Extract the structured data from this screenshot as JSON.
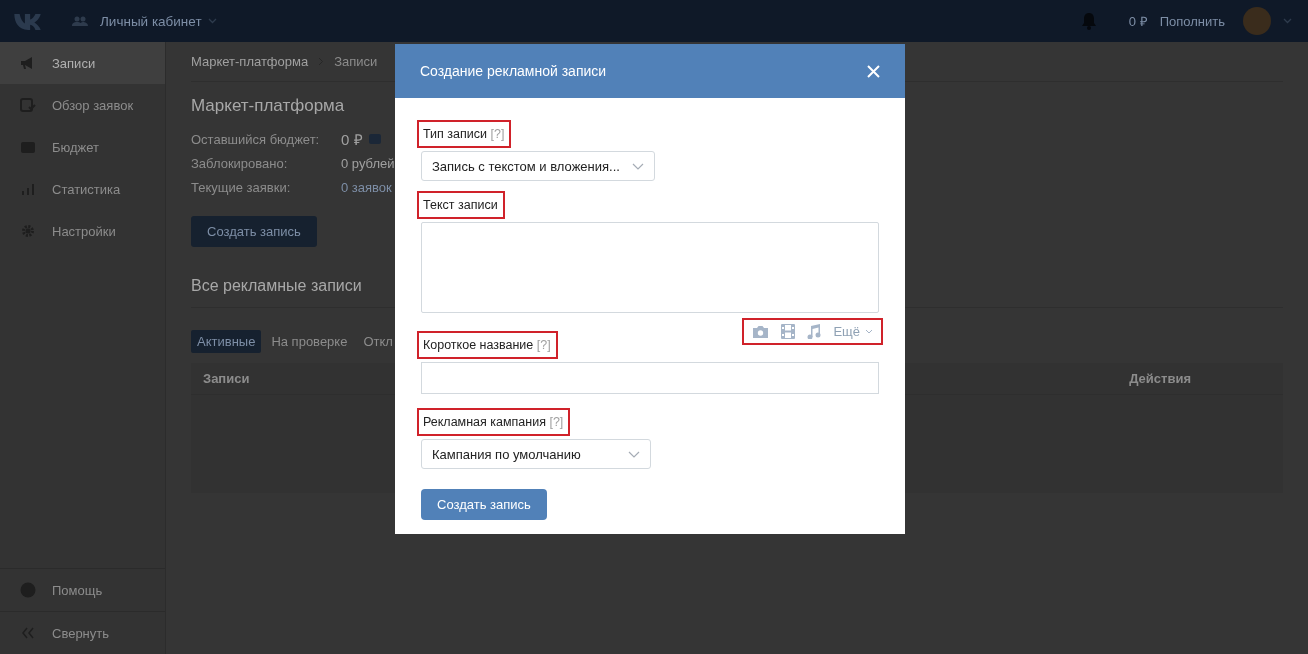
{
  "topbar": {
    "title": "Личный кабинет",
    "balance": "0 ₽",
    "topup": "Пополнить"
  },
  "sidebar": {
    "items": [
      {
        "label": "Записи",
        "selected": true
      },
      {
        "label": "Обзор заявок",
        "selected": false
      },
      {
        "label": "Бюджет",
        "selected": false
      },
      {
        "label": "Статистика",
        "selected": false
      },
      {
        "label": "Настройки",
        "selected": false
      }
    ],
    "footer": [
      {
        "label": "Помощь"
      },
      {
        "label": "Свернуть"
      }
    ]
  },
  "main": {
    "breadcrumbs": [
      "Маркет-платформа",
      "Записи"
    ],
    "title": "Маркет-платформа",
    "stats": [
      {
        "label": "Оставшийся бюджет:",
        "value": "0 ₽",
        "kind": "big"
      },
      {
        "label": "Заблокировано:",
        "value": "0 рублей",
        "kind": "plain"
      },
      {
        "label": "Текущие заявки:",
        "value": "0 заявок",
        "kind": "link"
      }
    ],
    "create_button": "Создать запись",
    "section_title": "Все рекламные записи",
    "tabs": [
      {
        "label": "Активные",
        "selected": true
      },
      {
        "label": "На проверке",
        "selected": false
      },
      {
        "label": "Откл",
        "selected": false
      }
    ],
    "table": {
      "columns": [
        "Записи",
        "Действия"
      ]
    }
  },
  "modal": {
    "title": "Создание рекламной записи",
    "fields": [
      {
        "kind": "select",
        "label": "Тип записи",
        "hint": "[?]",
        "value": "Запись с текстом и вложения...",
        "highlighted": true
      },
      {
        "kind": "textarea",
        "label": "Текст записи",
        "highlighted": true,
        "attachments": {
          "more": "Ещё",
          "highlighted": true
        }
      },
      {
        "kind": "input",
        "label": "Короткое название",
        "hint": "[?]",
        "highlighted": true
      },
      {
        "kind": "select",
        "label": "Рекламная кампания",
        "hint": "[?]",
        "value": "Кампания по умолчанию",
        "highlighted": true
      }
    ],
    "submit": "Создать запись"
  }
}
